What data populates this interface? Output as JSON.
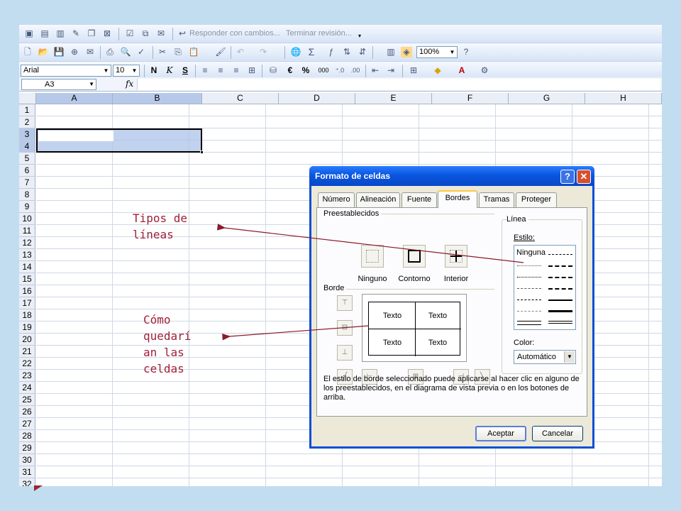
{
  "review_toolbar": {
    "reply_label": "Responder con cambios...",
    "end_review_label": "Terminar revisión..."
  },
  "standard_toolbar": {
    "zoom": "100%"
  },
  "format_toolbar": {
    "font": "Arial",
    "size": "10",
    "bold": "N",
    "italic": "K",
    "underline": "S",
    "currency": "€",
    "percent": "%",
    "thousands": "000"
  },
  "formula_bar": {
    "name_box": "A3",
    "fx": "fx"
  },
  "columns": [
    "A",
    "B",
    "C",
    "D",
    "E",
    "F",
    "G",
    "H"
  ],
  "rows": [
    "1",
    "2",
    "3",
    "4",
    "5",
    "6",
    "7",
    "8",
    "9",
    "10",
    "11",
    "12",
    "13",
    "14",
    "15",
    "16",
    "17",
    "18",
    "19",
    "20",
    "21",
    "22",
    "23",
    "24",
    "25",
    "26",
    "27",
    "28",
    "29",
    "30",
    "31",
    "32"
  ],
  "annotations": {
    "line_types": "Tipos de\nlíneas",
    "cell_look": "Cómo\nquedarí\nan las\nceldas"
  },
  "dialog": {
    "title": "Formato de celdas",
    "help_button": "?",
    "close_button": "✕",
    "tabs": [
      "Número",
      "Alineación",
      "Fuente",
      "Bordes",
      "Tramas",
      "Proteger"
    ],
    "presets_label": "Preestablecidos",
    "presets": [
      "Ninguno",
      "Contorno",
      "Interior"
    ],
    "border_label": "Borde",
    "preview_text": [
      "Texto",
      "Texto",
      "Texto",
      "Texto"
    ],
    "line_label": "Línea",
    "style_label": "Estilo:",
    "none_option": "Ninguna",
    "color_label": "Color:",
    "color_value": "Automático",
    "help_text": "El estilo de borde seleccionado puede aplicarse al hacer clic en alguno de los preestablecidos, en el diagrama de vista previa o en los botones de arriba.",
    "ok": "Aceptar",
    "cancel": "Cancelar"
  },
  "colors": {
    "background": "#c3ddf0",
    "annotation": "#a02038",
    "title_bar": "#0a4fd6",
    "selection": "#acc3e8"
  }
}
